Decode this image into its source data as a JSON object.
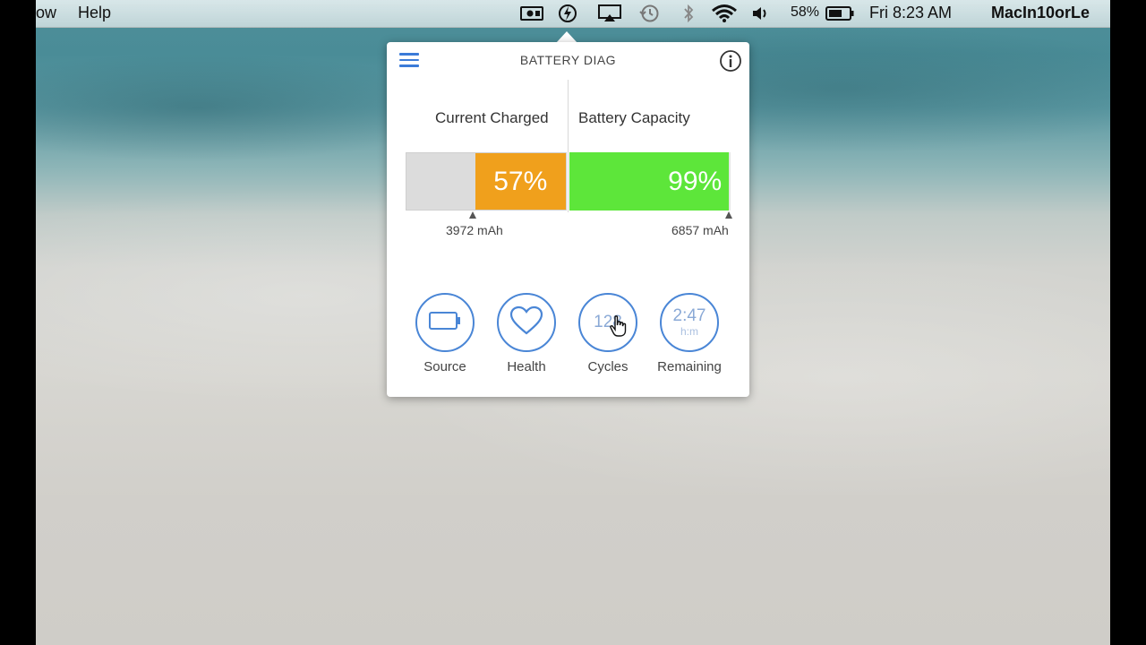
{
  "menubar": {
    "left_items": [
      "ow",
      "Help"
    ],
    "battery_percent": "58%",
    "clock": "Fri 8:23 AM",
    "user": "MacIn10orLe"
  },
  "popover": {
    "title": "BATTERY DIAG",
    "current_charged_label": "Current Charged",
    "battery_capacity_label": "Battery Capacity",
    "current_charged_percent": "57%",
    "current_charged_value": 57,
    "battery_capacity_percent": "99%",
    "battery_capacity_value": 99,
    "current_mah": "3972 mAh",
    "capacity_mah": "6857 mAh",
    "buttons": [
      {
        "label": "Source",
        "icon": "battery-icon"
      },
      {
        "label": "Health",
        "icon": "heart-icon"
      },
      {
        "label": "Cycles",
        "value": "128"
      },
      {
        "label": "Remaining",
        "value": "2:47",
        "unit": "h:m"
      }
    ]
  },
  "colors": {
    "accent": "#4a86d6",
    "charged": "#f0a01c",
    "capacity": "#5de63a"
  }
}
